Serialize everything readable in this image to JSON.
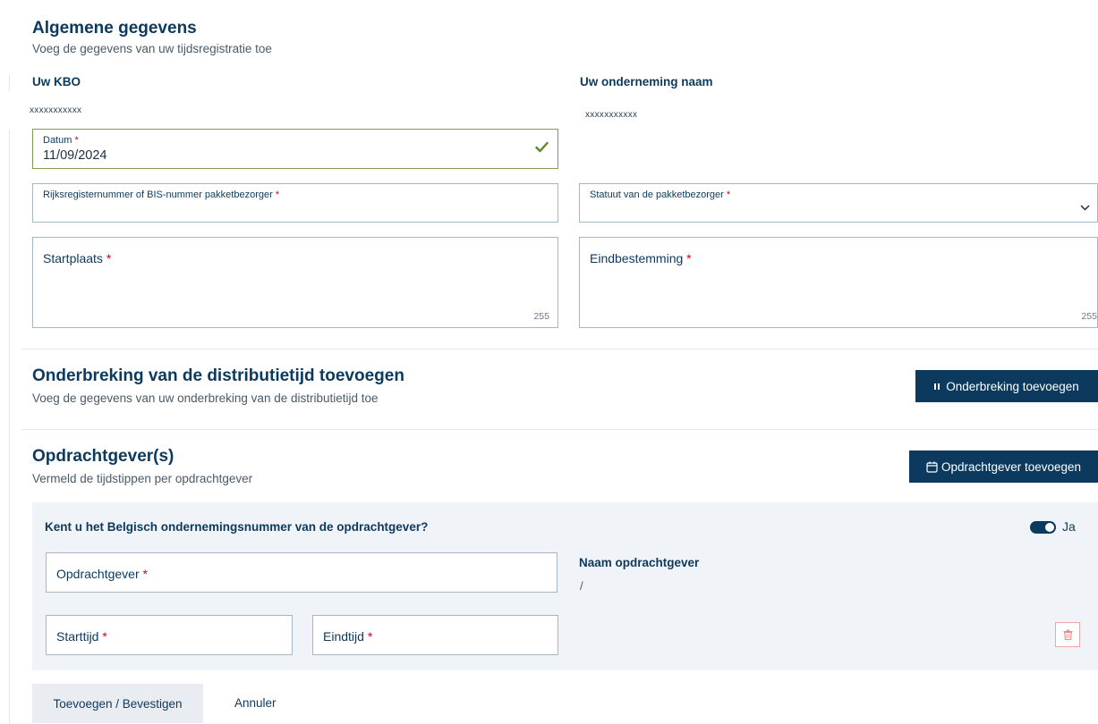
{
  "general": {
    "title": "Algemene gegevens",
    "subtitle": "Voeg de gegevens van uw tijdsregistratie toe",
    "kbo_label": "Uw KBO",
    "kbo_value": "xxxxxxxxxxx",
    "company_label": "Uw onderneming naam",
    "company_value": "xxxxxxxxxxx",
    "date_label": "Datum",
    "date_value": "11/09/2024",
    "rrn_label": "Rijksregisternummer of BIS-nummer pakketbezorger",
    "statute_label": "Statuut van de pakketbezorger",
    "start_label": "Startplaats",
    "start_counter": "255",
    "destination_label": "Eindbestemming",
    "destination_counter": "255",
    "required_mark": "*"
  },
  "interruption": {
    "title": "Onderbreking van de distributietijd toevoegen",
    "subtitle": "Voeg de gegevens van uw onderbreking van de distributietijd toe",
    "button_label": "Onderbreking toevoegen"
  },
  "clients": {
    "title": "Opdrachtgever(s)",
    "subtitle": "Vermeld de tijdstippen per opdrachtgever",
    "button_label": "Opdrachtgever toevoegen",
    "question": "Kent u het Belgisch ondernemingsnummer van de opdrachtgever?",
    "toggle_label": "Ja",
    "client_label": "Opdrachtgever",
    "client_name_label": "Naam opdrachtgever",
    "client_name_value": "/",
    "start_time_label": "Starttijd",
    "end_time_label": "Eindtijd"
  },
  "actions": {
    "confirm_label": "Toevoegen / Bevestigen",
    "cancel_label": "Annuler"
  },
  "colors": {
    "primary": "#0b3a5e",
    "valid": "#5a8a2b",
    "required": "#d0021b",
    "panel": "#f0f3f8"
  }
}
